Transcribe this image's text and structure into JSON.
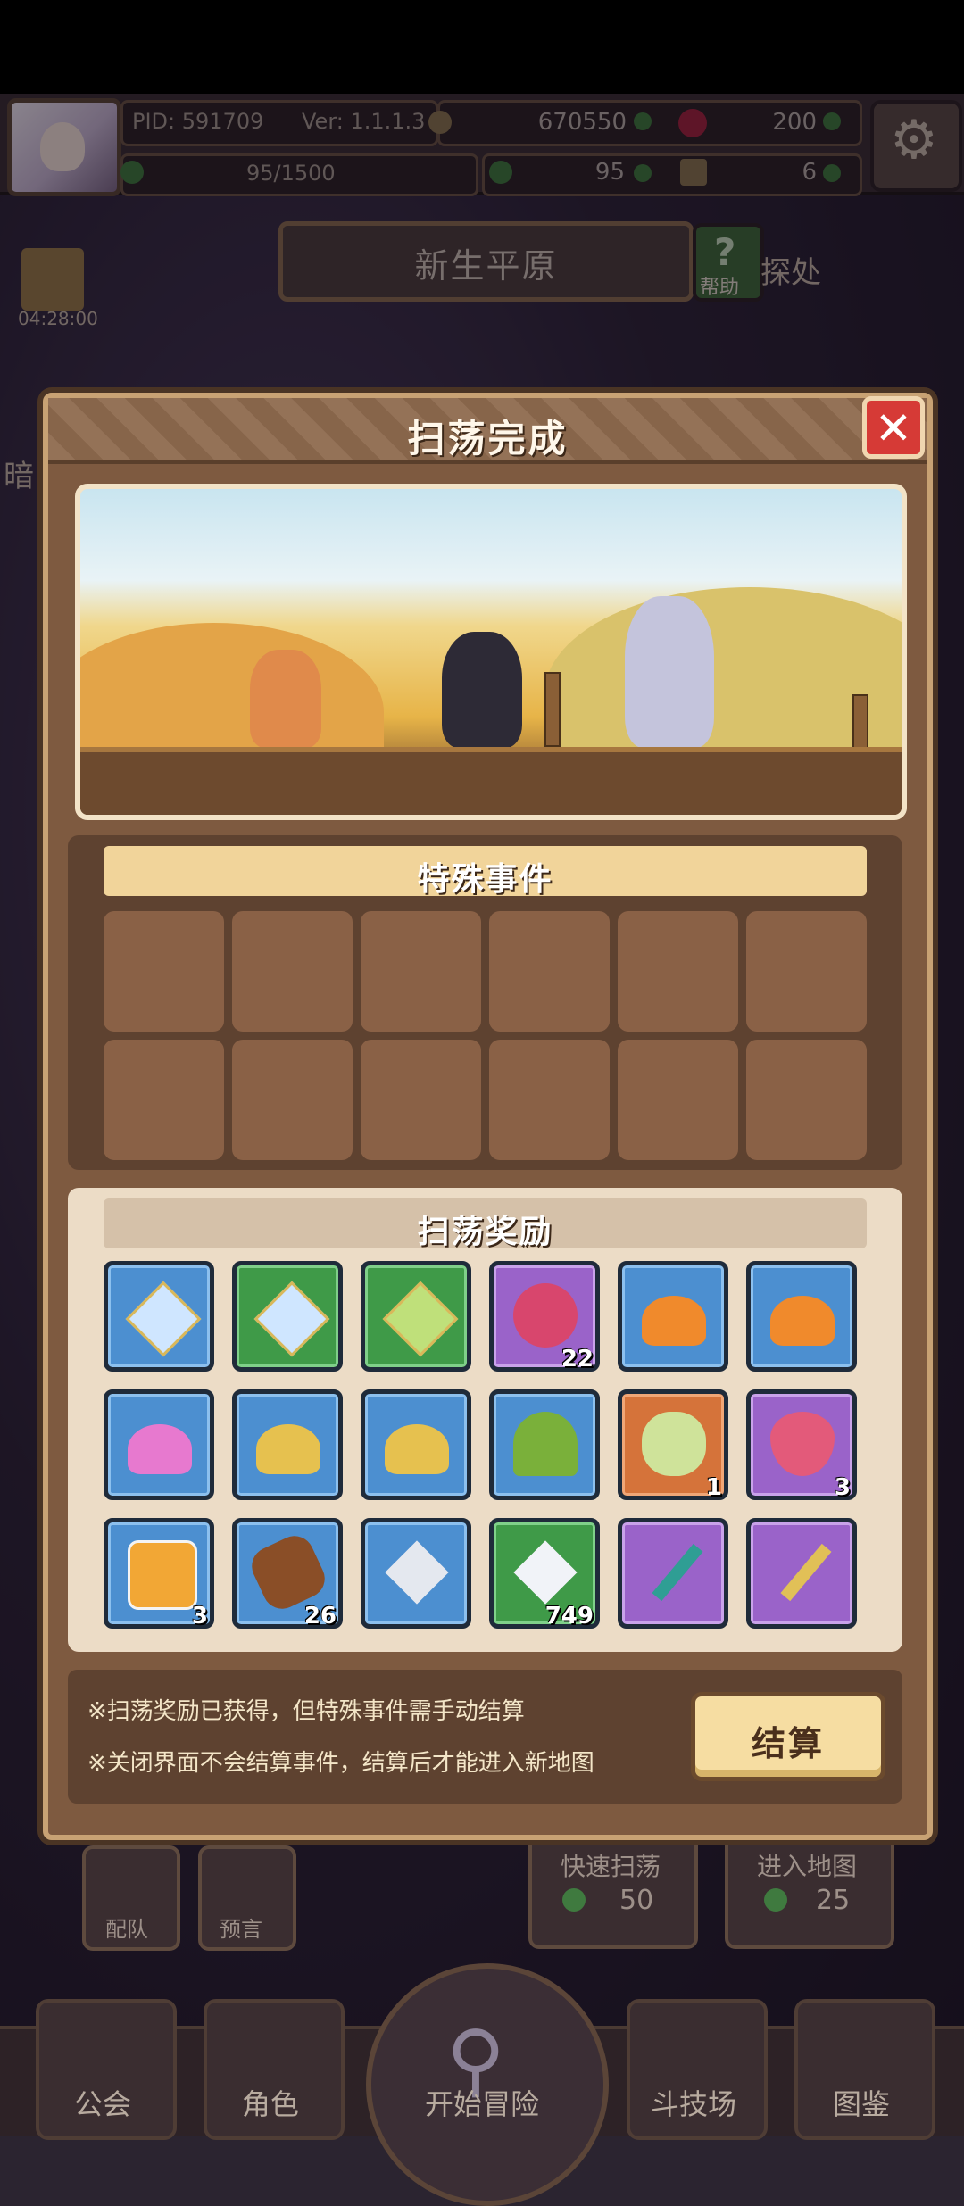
{
  "hud": {
    "pid": "PID: 591709",
    "ver": "Ver: 1.1.1.3",
    "gold": "670550",
    "gems": "200",
    "stamina": "95/1500",
    "clover": "95",
    "keys": "6"
  },
  "map": {
    "name": "新生平原",
    "help_label": "帮助",
    "side_right": "探处",
    "side_left": "暗",
    "gift_timer": "04:28:00"
  },
  "modal": {
    "title": "扫荡完成",
    "close_icon": "close-icon",
    "special_events_title": "特殊事件",
    "rewards_title": "扫荡奖励",
    "rewards": [
      {
        "icon": "blue-crystal-icon",
        "color": "blue",
        "count": ""
      },
      {
        "icon": "blue-crystal-icon",
        "color": "green",
        "count": ""
      },
      {
        "icon": "green-crystal-icon",
        "color": "green",
        "count": ""
      },
      {
        "icon": "berry-icon",
        "color": "purple",
        "count": "22"
      },
      {
        "icon": "sleeping-slime-icon",
        "color": "blue",
        "count": ""
      },
      {
        "icon": "sleeping-slime-icon",
        "color": "blue",
        "count": ""
      },
      {
        "icon": "pink-slime-icon",
        "color": "blue",
        "count": ""
      },
      {
        "icon": "yellow-slime-icon",
        "color": "blue",
        "count": ""
      },
      {
        "icon": "yellow-slime-icon",
        "color": "blue",
        "count": ""
      },
      {
        "icon": "sprout-icon",
        "color": "blue",
        "count": ""
      },
      {
        "icon": "cabbage-icon",
        "color": "orange",
        "count": "1"
      },
      {
        "icon": "strawberry-icon",
        "color": "purple",
        "count": "3"
      },
      {
        "icon": "potion-jar-icon",
        "color": "blue",
        "count": "3"
      },
      {
        "icon": "wood-log-icon",
        "color": "blue",
        "count": "26"
      },
      {
        "icon": "silver-gem-icon",
        "color": "blue",
        "count": ""
      },
      {
        "icon": "diamond-icon",
        "color": "green",
        "count": "749"
      },
      {
        "icon": "teal-staff-icon",
        "color": "purple",
        "count": ""
      },
      {
        "icon": "flower-wand-icon",
        "color": "purple",
        "count": ""
      }
    ],
    "note1": "※扫荡奖励已获得，但特殊事件需手动结算",
    "note2": "※关闭界面不会结算事件，结算后才能进入新地图",
    "settle_label": "结算"
  },
  "lower": {
    "team_label": "配队",
    "prophecy_label": "预言",
    "quick_sweep_label": "快速扫荡",
    "quick_sweep_cost": "50",
    "enter_map_label": "进入地图",
    "enter_map_cost": "25"
  },
  "nav": {
    "guild": "公会",
    "character": "角色",
    "start": "开始冒险",
    "arena": "斗技场",
    "codex": "图鉴"
  },
  "colors": {
    "slot_blue": "#4c8fd0",
    "slot_green": "#3f9a48",
    "slot_purple": "#9a63c9",
    "slot_orange": "#d5733a",
    "close_red": "#d63a36",
    "settle_button": "#f6dda2"
  }
}
